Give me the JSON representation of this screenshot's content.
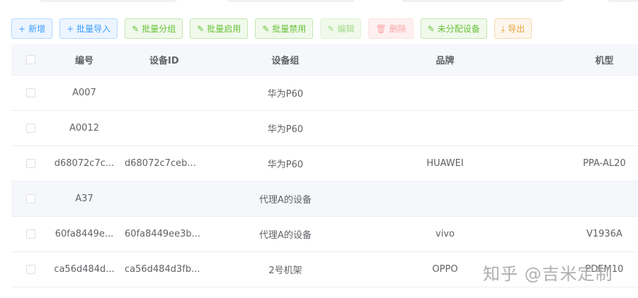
{
  "toolbar": {
    "add": {
      "label": "新增",
      "icon": "+"
    },
    "import": {
      "label": "批量导入",
      "icon": "+"
    },
    "group": {
      "label": "批量分组",
      "icon": "✎"
    },
    "enable": {
      "label": "批量启用",
      "icon": "✎"
    },
    "disable": {
      "label": "批量禁用",
      "icon": "✎"
    },
    "edit": {
      "label": "编辑",
      "icon": "✎"
    },
    "delete": {
      "label": "删除",
      "icon": "🗑"
    },
    "unassigned": {
      "label": "未分配设备",
      "icon": "✎"
    },
    "export": {
      "label": "导出",
      "icon": "⤓"
    }
  },
  "table": {
    "headers": {
      "number": "编号",
      "device_id": "设备ID",
      "device_group": "设备组",
      "brand": "品牌",
      "model": "机型"
    },
    "rows": [
      {
        "number": "A007",
        "device_id": "",
        "device_group": "华为P60",
        "brand": "",
        "model": ""
      },
      {
        "number": "A0012",
        "device_id": "",
        "device_group": "华为P60",
        "brand": "",
        "model": ""
      },
      {
        "number": "d68072c7c...",
        "device_id": "d68072c7ceb...",
        "device_group": "华为P60",
        "brand": "HUAWEI",
        "model": "PPA-AL20"
      },
      {
        "number": "A37",
        "device_id": "",
        "device_group": "代理A的设备",
        "brand": "",
        "model": ""
      },
      {
        "number": "60fa8449e...",
        "device_id": "60fa8449ee3b...",
        "device_group": "代理A的设备",
        "brand": "vivo",
        "model": "V1936A"
      },
      {
        "number": "ca56d484d...",
        "device_id": "ca56d484d3fb...",
        "device_group": "2号机架",
        "brand": "OPPO",
        "model": "PDEM10"
      }
    ]
  },
  "watermark": "知乎 @吉米定制"
}
